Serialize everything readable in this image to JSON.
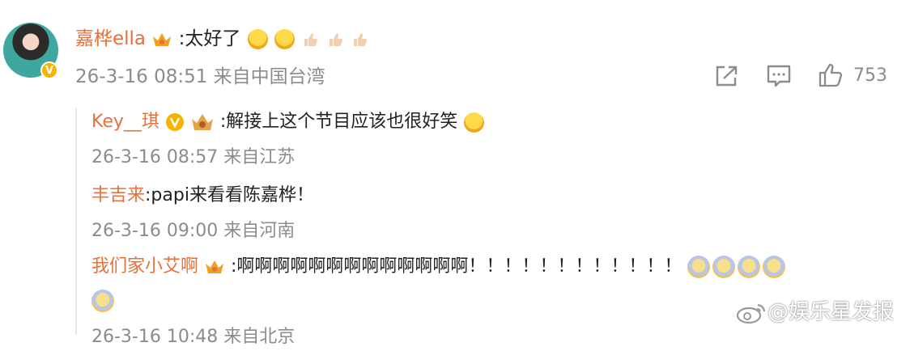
{
  "main_comment": {
    "username": "嘉桦ella",
    "text": ":太好了",
    "timestamp": "26-3-16 08:51 来自中国台湾",
    "like_count": "753"
  },
  "replies": [
    {
      "username": "Key__琪",
      "text": ":解接上这个节目应该也很好笑",
      "timestamp": "26-3-16 08:57 来自江苏"
    },
    {
      "username": "丰吉来",
      "text": ":papi来看看陈嘉桦！",
      "timestamp": "26-3-16 09:00 来自河南"
    },
    {
      "username": "我们家小艾啊",
      "text": ":啊啊啊啊啊啊啊啊啊啊啊啊啊！！！！！！！！！！！！",
      "timestamp": "26-3-16 10:48 来自北京"
    }
  ],
  "watermark": {
    "text": "@娱乐星发报"
  },
  "icons": {
    "share": "share-icon",
    "comment": "comment-icon",
    "like": "thumbs-up-icon"
  },
  "colors": {
    "username": "#e8703a",
    "text": "#222222",
    "meta": "#8c8c8c"
  }
}
